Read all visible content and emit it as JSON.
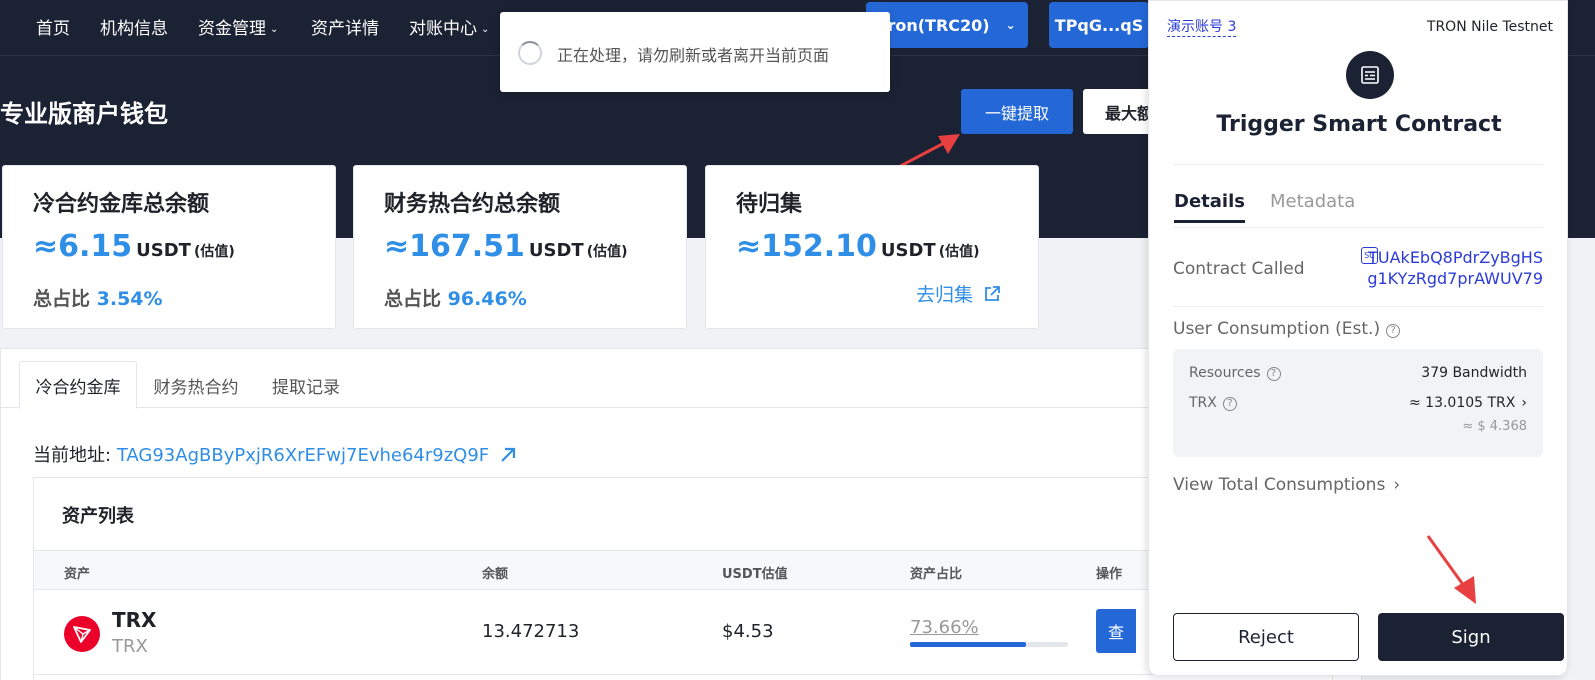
{
  "nav": {
    "items": [
      "首页",
      "机构信息",
      "资金管理",
      "资产详情",
      "对账中心"
    ],
    "network": "Tron(TRC20)",
    "address_short": "TPqG...qS"
  },
  "toast": {
    "text": "正在处理，请勿刷新或者离开当前页面"
  },
  "header": {
    "title": "专业版商户钱包",
    "withdraw_label": "一键提取",
    "max_label": "最大额"
  },
  "cards": [
    {
      "title": "冷合约金库总余额",
      "amount": "≈6.15",
      "unit": "USDT",
      "est": "(估值)",
      "ratio_label": "总占比",
      "ratio": "3.54%"
    },
    {
      "title": "财务热合约总余额",
      "amount": "≈167.51",
      "unit": "USDT",
      "est": "(估值)",
      "ratio_label": "总占比",
      "ratio": "96.46%"
    },
    {
      "title": "待归集",
      "amount": "≈152.10",
      "unit": "USDT",
      "est": "(估值)",
      "link": "去归集"
    }
  ],
  "tabs": [
    "冷合约金库",
    "财务热合约",
    "提取记录"
  ],
  "address": {
    "label": "当前地址:",
    "value": "TAG93AgBByPxjR6XrEFwj7Evhe64r9zQ9F"
  },
  "asset_list": {
    "title": "资产列表",
    "columns": [
      "资产",
      "余额",
      "USDT估值",
      "资产占比",
      "操作"
    ],
    "rows": [
      {
        "symbol": "TRX",
        "name": "TRX",
        "balance": "13.472713",
        "usdt": "$4.53",
        "percent": "73.66%",
        "fraction": 0.7366,
        "action": "查"
      }
    ]
  },
  "wallet": {
    "account": "演示账号 3",
    "network": "TRON Nile Testnet",
    "title": "Trigger Smart Contract",
    "tabs": [
      "Details",
      "Metadata"
    ],
    "contract_label": "Contract Called",
    "sc_badge": "SC",
    "contract_address": "TUAkEbQ8PdrZyBgHSg1KYzRgd7prAWUV79",
    "consumption_label": "User Consumption (Est.)",
    "resources_label": "Resources",
    "resources_value": "379 Bandwidth",
    "trx_label": "TRX",
    "trx_value": "≈ 13.0105 TRX",
    "usd_value": "≈ $ 4.368",
    "view_total": "View Total Consumptions",
    "reject": "Reject",
    "sign": "Sign"
  },
  "colors": {
    "accent": "#2468d8",
    "link": "#2f8ee6",
    "dark": "#1b2233",
    "wallet_link": "#2b3bd8",
    "annotation": "#e84040"
  }
}
